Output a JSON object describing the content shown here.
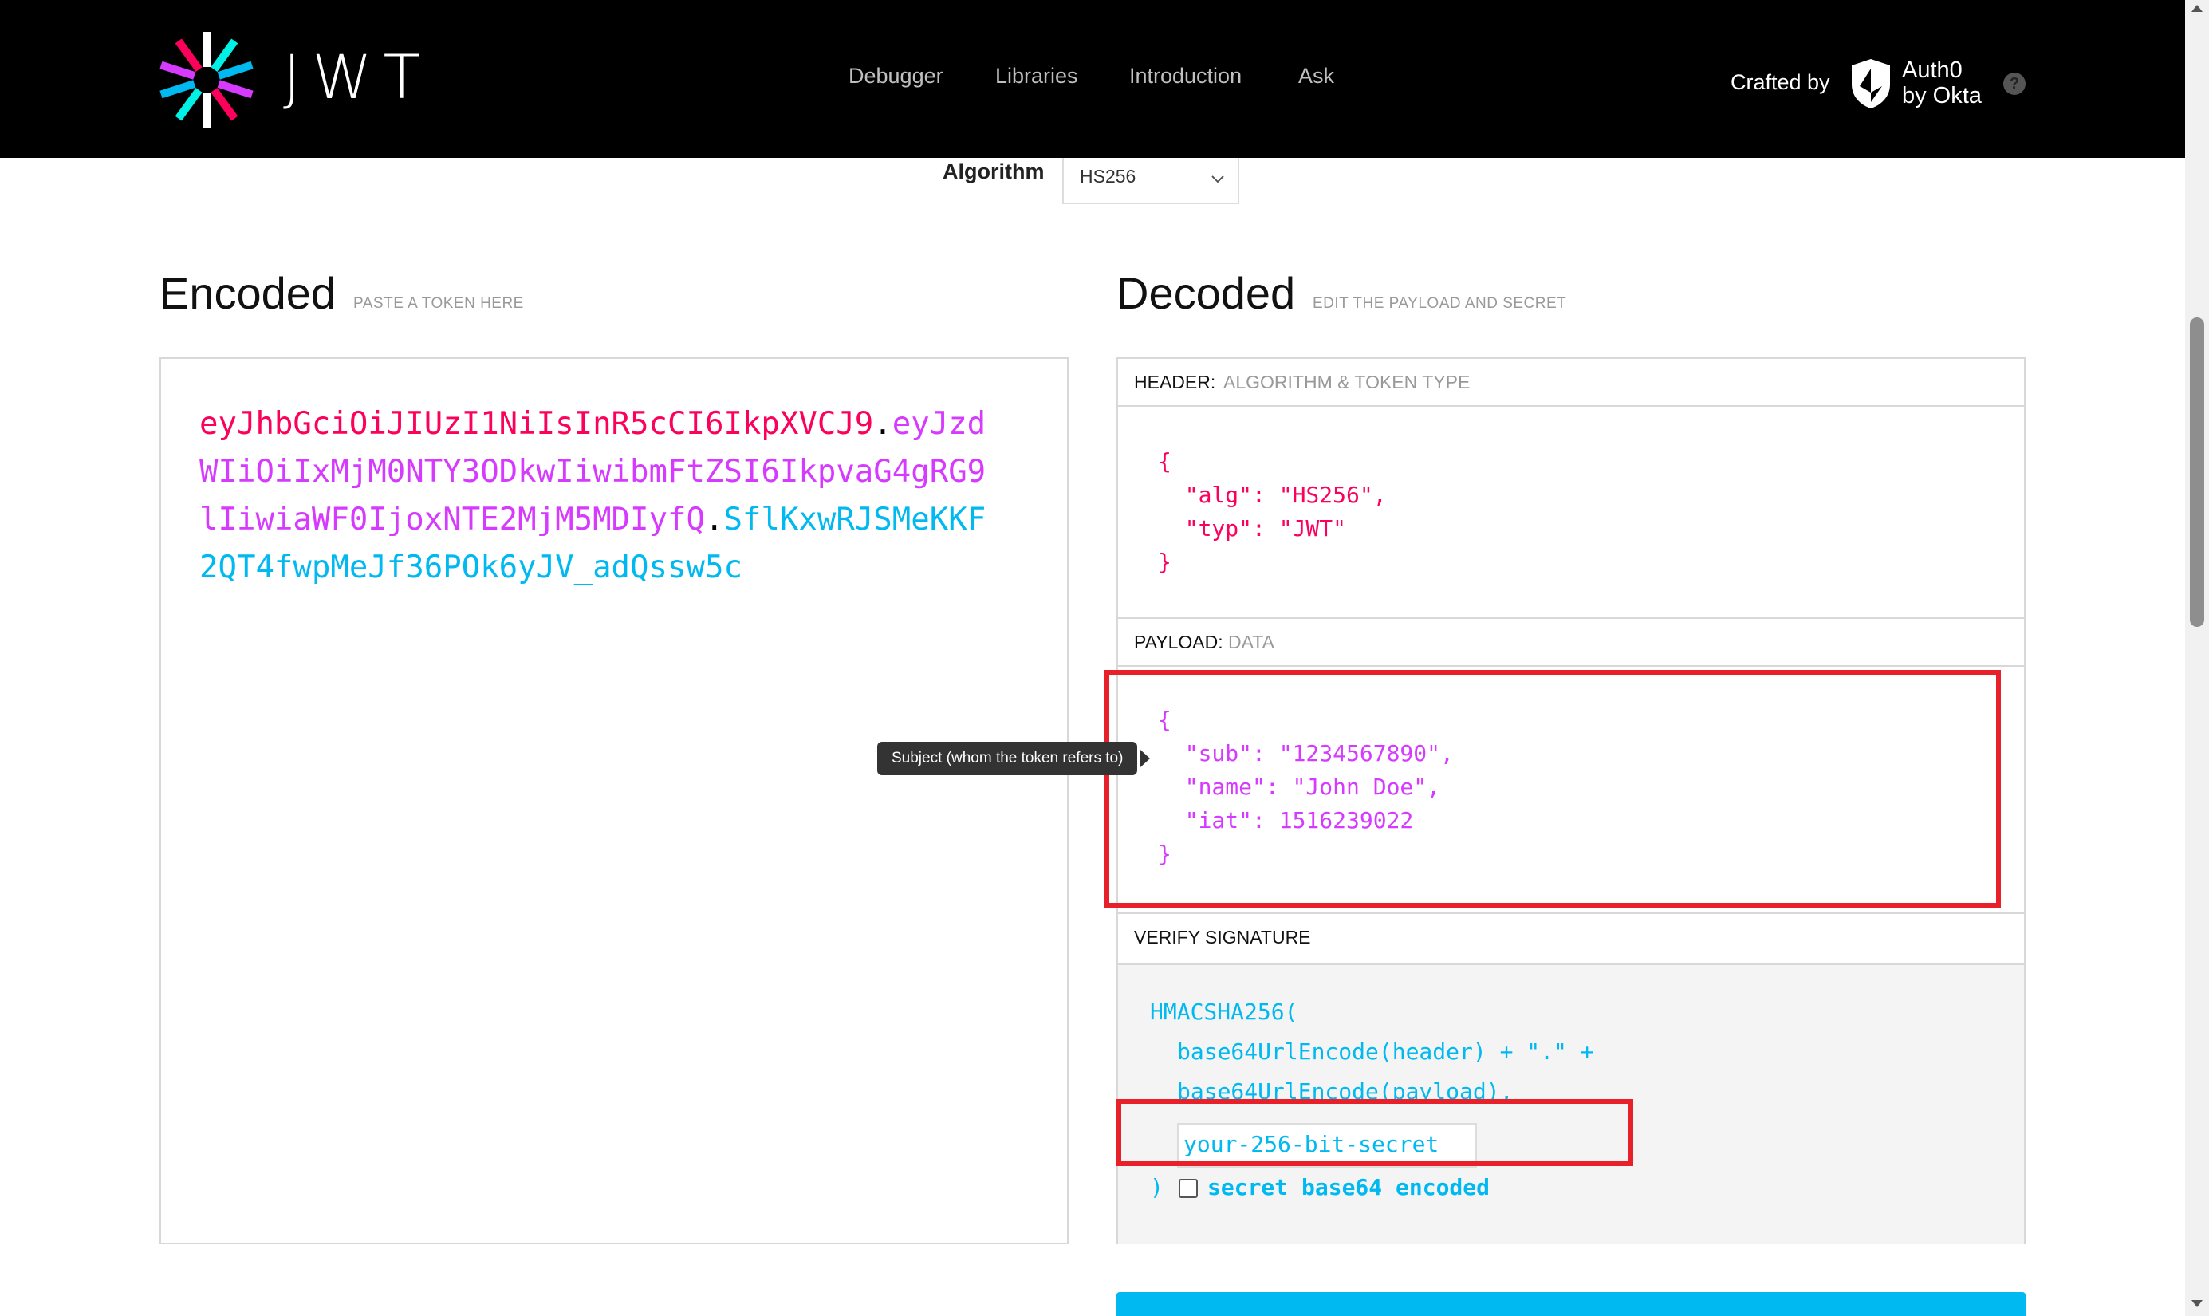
{
  "header": {
    "logo_text": "JWT",
    "nav": [
      "Debugger",
      "Libraries",
      "Introduction",
      "Ask"
    ],
    "crafted_by": "Crafted by",
    "auth0_line1": "Auth0",
    "auth0_line2": "by Okta",
    "help": "?"
  },
  "algorithm": {
    "label": "Algorithm",
    "value": "HS256"
  },
  "encoded": {
    "title": "Encoded",
    "subtitle": "PASTE A TOKEN HERE",
    "token_header": "eyJhbGciOiJIUzI1NiIsInR5cCI6IkpXVCJ9",
    "token_payload": "eyJzdWIiOiIxMjM0NTY3ODkwIiwibmFtZSI6IkpvaG4gRG9lIiwiaWF0IjoxNTE2MjM5MDIyfQ",
    "token_signature": "SflKxwRJSMeKKF2QT4fwpMeJf36POk6yJV_adQssw5c",
    "dot": "."
  },
  "decoded": {
    "title": "Decoded",
    "subtitle": "EDIT THE PAYLOAD AND SECRET",
    "header_label": "HEADER:",
    "header_sub": "ALGORITHM & TOKEN TYPE",
    "header_json": "{\n  \"alg\": \"HS256\",\n  \"typ\": \"JWT\"\n}",
    "payload_label": "PAYLOAD:",
    "payload_sub": "DATA",
    "payload_json": "{\n  \"sub\": \"1234567890\",\n  \"name\": \"John Doe\",\n  \"iat\": 1516239022\n}",
    "verify_label": "VERIFY SIGNATURE",
    "sig_line1": "HMACSHA256(",
    "sig_line2": "base64UrlEncode(header) + \".\" +",
    "sig_line3": "base64UrlEncode(payload),",
    "secret_value": "your-256-bit-secret",
    "close_paren": ")",
    "b64_label": "secret base64 encoded"
  },
  "tooltip": "Subject (whom the token refers to)",
  "colors": {
    "header_part": "#fb015b",
    "payload_part": "#d63aff",
    "signature_part": "#00b9f1",
    "highlight": "#e8202a"
  }
}
